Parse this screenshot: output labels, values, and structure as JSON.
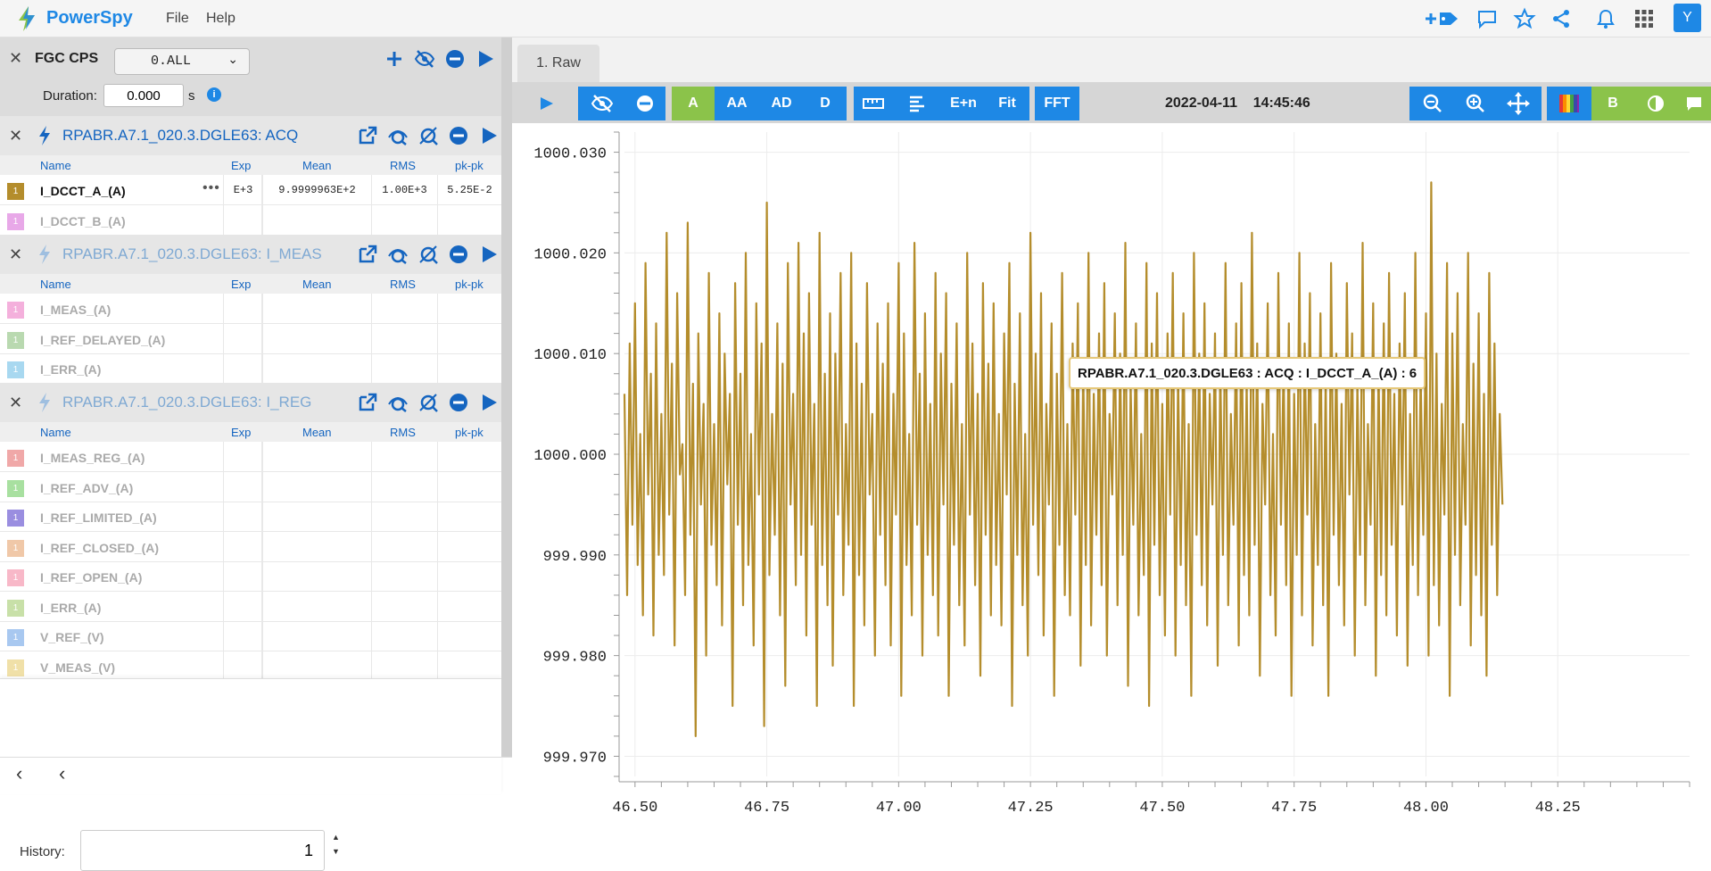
{
  "app": {
    "title": "PowerSpy",
    "menu": [
      "File",
      "Help"
    ],
    "avatar": "Y"
  },
  "topbar_icons": [
    "add-tag-icon",
    "comment-icon",
    "star-icon",
    "share-icon",
    "bell-icon",
    "apps-grid-icon"
  ],
  "device": {
    "name": "FGC CPS",
    "selector": "0.ALL",
    "duration_label": "Duration:",
    "duration_value": "0.000",
    "duration_unit": "s"
  },
  "columns": {
    "name": "Name",
    "exp": "Exp",
    "mean": "Mean",
    "rms": "RMS",
    "pkpk": "pk-pk"
  },
  "groups": [
    {
      "title": "RPABR.A7.1_020.3.DGLE63: ACQ",
      "active": true,
      "signals": [
        {
          "name": "I_DCCT_A_(A)",
          "badge": "1",
          "color": "#b48d2c",
          "exp": "E+3",
          "mean": "9.9999963E+2",
          "rms": "1.00E+3",
          "pkpk": "5.25E-2",
          "active": true
        },
        {
          "name": "I_DCCT_B_(A)",
          "badge": "1",
          "color": "#e8a8e8",
          "exp": "",
          "mean": "",
          "rms": "",
          "pkpk": "",
          "active": false
        }
      ]
    },
    {
      "title": "RPABR.A7.1_020.3.DGLE63: I_MEAS",
      "active": false,
      "signals": [
        {
          "name": "I_MEAS_(A)",
          "badge": "1",
          "color": "#f4b0dc",
          "active": false
        },
        {
          "name": "I_REF_DELAYED_(A)",
          "badge": "1",
          "color": "#b9d9b0",
          "active": false
        },
        {
          "name": "I_ERR_(A)",
          "badge": "1",
          "color": "#a8d8f0",
          "active": false
        }
      ]
    },
    {
      "title": "RPABR.A7.1_020.3.DGLE63: I_REG",
      "active": false,
      "signals": [
        {
          "name": "I_MEAS_REG_(A)",
          "badge": "1",
          "color": "#f0a8a8",
          "active": false
        },
        {
          "name": "I_REF_ADV_(A)",
          "badge": "1",
          "color": "#a8e0a0",
          "active": false
        },
        {
          "name": "I_REF_LIMITED_(A)",
          "badge": "1",
          "color": "#9a8ee0",
          "active": false
        },
        {
          "name": "I_REF_CLOSED_(A)",
          "badge": "1",
          "color": "#f0c8a8",
          "active": false
        },
        {
          "name": "I_REF_OPEN_(A)",
          "badge": "1",
          "color": "#f8b8c8",
          "active": false
        },
        {
          "name": "I_ERR_(A)",
          "badge": "1",
          "color": "#c8e0a8",
          "active": false
        },
        {
          "name": "V_REF_(V)",
          "badge": "1",
          "color": "#a8c8f0",
          "active": false
        },
        {
          "name": "V_MEAS_(V)",
          "badge": "1",
          "color": "#f0e0a8",
          "active": false
        }
      ]
    }
  ],
  "history": {
    "label": "History:",
    "value": "1"
  },
  "tabs": [
    "1. Raw"
  ],
  "toolbar": {
    "mode_buttons": [
      "A",
      "AA",
      "AD",
      "D"
    ],
    "tools": [
      "E+n",
      "Fit",
      "FFT"
    ],
    "date": "2022-04-11",
    "time": "14:45:46",
    "b_label": "B"
  },
  "tooltip": "RPABR.A7.1_020.3.DGLE63 : ACQ : I_DCCT_A_(A) : 6",
  "colors": {
    "accent": "#1e88e5",
    "green": "#8bc34a",
    "series": "#b48d2c"
  },
  "chart_data": {
    "type": "line",
    "title": "",
    "xlabel": "",
    "ylabel": "",
    "xlim": [
      46.48,
      48.5
    ],
    "ylim": [
      999.968,
      1000.032
    ],
    "x_ticks": [
      46.5,
      46.75,
      47.0,
      47.25,
      47.5,
      47.75,
      48.0,
      48.25
    ],
    "x_tick_labels": [
      "46.50",
      "46.75",
      "47.00",
      "47.25",
      "47.50",
      "47.75",
      "48.00",
      "48.25"
    ],
    "y_ticks": [
      999.97,
      999.98,
      999.99,
      1000.0,
      1000.01,
      1000.02,
      1000.03
    ],
    "y_tick_labels": [
      "999.970",
      "999.980",
      "999.990",
      "1000.000",
      "1000.010",
      "1000.020",
      "1000.030"
    ],
    "grid": true,
    "series": [
      {
        "name": "I_DCCT_A_(A)",
        "color": "#b48d2c",
        "x_start": 46.48,
        "x_step": 0.005,
        "y": [
          1000.006,
          999.986,
          1000.011,
          999.993,
          1000.015,
          999.989,
          1000.002,
          999.984,
          1000.019,
          999.996,
          1000.008,
          999.982,
          1000.013,
          999.99,
          1000.004,
          999.988,
          1000.022,
          999.994,
          1000.009,
          999.981,
          1000.016,
          999.998,
          1000.001,
          999.986,
          1000.023,
          999.992,
          1000.007,
          999.972,
          1000.012,
          999.995,
          1000.005,
          999.98,
          1000.018,
          999.991,
          1000.003,
          999.987,
          1000.014,
          999.983,
          1000.01,
          999.997,
          1000.006,
          999.975,
          1000.017,
          999.993,
          1000.008,
          999.985,
          1000.02,
          999.989,
          1000.002,
          999.981,
          1000.015,
          999.996,
          1000.011,
          999.973,
          1000.025,
          999.988,
          1000.004,
          999.992,
          1000.013,
          999.984,
          1000.009,
          999.977,
          1000.019,
          999.995,
          1000.006,
          999.987,
          1000.021,
          999.99,
          1000.012,
          999.982,
          1000.016,
          999.993,
          1000.005,
          999.975,
          1000.022,
          999.989,
          1000.008,
          999.985,
          1000.014,
          999.979,
          1000.01,
          999.994,
          1000.018,
          999.986,
          1000.003,
          999.991,
          1000.02,
          999.975,
          1000.011,
          999.988,
          1000.007,
          999.983,
          1000.017,
          999.996,
          1000.004,
          999.98,
          1000.013,
          999.992,
          1000.009,
          999.987,
          1000.015,
          999.981,
          1000.006,
          999.994,
          1000.019,
          999.976,
          1000.012,
          999.989,
          1000.002,
          999.984,
          1000.021,
          999.993,
          1000.008,
          999.98,
          1000.014,
          999.99,
          1000.005,
          999.986,
          1000.018,
          999.982,
          1000.01,
          999.995,
          1000.016,
          999.976,
          1000.007,
          999.991,
          1000.013,
          999.985,
          1000.003,
          999.981,
          1000.02,
          999.994,
          1000.011,
          999.987,
          1000.006,
          999.978,
          1000.017,
          999.992,
          1000.009,
          999.984,
          1000.015,
          999.989,
          1000.004,
          999.983,
          1000.012,
          999.996,
          1000.019,
          999.975,
          1000.007,
          999.99,
          1000.014,
          999.985,
          1000.002,
          999.98,
          1000.022,
          999.993,
          1000.01,
          999.988,
          1000.016,
          999.982,
          1000.005,
          999.995,
          1000.013,
          999.976,
          1000.008,
          999.991,
          1000.018,
          999.986,
          1000.003,
          999.984,
          1000.011,
          999.994,
          1000.015,
          999.979,
          1000.009,
          999.989,
          1000.02,
          999.983,
          1000.006,
          999.992,
          1000.012,
          999.987,
          1000.017,
          999.98,
          1000.004,
          999.996,
          1000.014,
          999.985,
          1000.01,
          999.99,
          1000.021,
          999.977,
          1000.007,
          999.993,
          1000.013,
          999.984,
          1000.002,
          999.988,
          1000.019,
          999.975,
          1000.011,
          999.991,
          1000.016,
          999.986,
          1000.005,
          999.982,
          1000.012,
          999.994,
          1000.018,
          999.98,
          1000.008,
          999.989,
          1000.014,
          999.985,
          1000.003,
          999.976,
          1000.02,
          999.992,
          1000.01,
          999.987,
          1000.015,
          999.983,
          1000.006,
          999.995,
          1000.012,
          999.979,
          1000.009,
          999.99,
          1000.019,
          999.985,
          1000.004,
          999.993,
          1000.013,
          999.981,
          1000.017,
          999.988,
          1000.007,
          999.984,
          1000.022,
          999.991,
          1000.011,
          999.978,
          1000.005,
          999.995,
          1000.015,
          999.986,
          1000.002,
          999.982,
          1000.018,
          999.993,
          1000.009,
          999.987,
          1000.013,
          999.976,
          1000.006,
          999.99,
          1000.02,
          999.984,
          1000.011,
          999.994,
          1000.016,
          999.981,
          1000.003,
          999.989,
          1000.014,
          999.985,
          1000.008,
          999.976,
          1000.019,
          999.992,
          1000.01,
          999.987,
          1000.005,
          999.983,
          1000.017,
          999.996,
          1000.012,
          999.98,
          1000.007,
          999.99,
          1000.021,
          999.985,
          1000.003,
          999.993,
          1000.015,
          999.978,
          1000.009,
          999.988,
          1000.013,
          999.984,
          1000.018,
          999.991,
          1000.006,
          999.982,
          1000.011,
          999.995,
          1000.016,
          999.979,
          1000.004,
          999.989,
          1000.02,
          999.986,
          1000.008,
          999.992,
          1000.014,
          999.98,
          1000.027,
          999.987,
          1000.01,
          999.983,
          1000.005,
          999.994,
          1000.019,
          999.976,
          1000.012,
          999.99,
          1000.016,
          999.985,
          1000.003,
          999.993,
          1000.02,
          999.981,
          1000.009,
          999.988,
          1000.014,
          999.984,
          1000.006,
          999.978,
          1000.018,
          999.991,
          1000.011,
          999.986,
          1000.004,
          999.995
        ]
      }
    ]
  }
}
